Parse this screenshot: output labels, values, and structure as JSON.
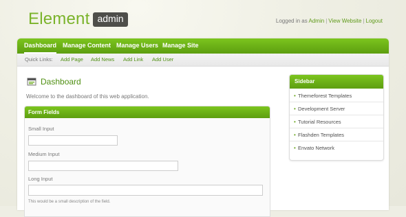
{
  "header": {
    "logo_word": "Element",
    "logo_badge": "admin",
    "logged_in_prefix": "Logged in as",
    "links": [
      "Admin",
      "View Website",
      "Logout"
    ]
  },
  "nav": {
    "items": [
      "Dashboard",
      "Manage Content",
      "Manage Users",
      "Manage Site"
    ],
    "active": "Dashboard"
  },
  "subnav": {
    "label": "Quick Links:",
    "items": [
      "Add Page",
      "Add News",
      "Add Link",
      "Add User"
    ]
  },
  "main": {
    "title": "Dashboard",
    "welcome": "Welcome to the dashboard of this web application."
  },
  "form": {
    "heading": "Form Fields",
    "fields": [
      {
        "label": "Small Input",
        "value": ""
      },
      {
        "label": "Medium Input",
        "value": ""
      },
      {
        "label": "Long Input",
        "value": ""
      }
    ],
    "help_text": "This would be a small description of the field."
  },
  "sidebar": {
    "heading": "Sidebar",
    "items": [
      "Themeforest Templates",
      "Development Server",
      "Tutorial Resources",
      "Flashden Templates",
      "Envato Network"
    ]
  },
  "colors": {
    "accent": "#6aac16",
    "link": "#4f8f12",
    "badge": "#4e4e4a"
  }
}
